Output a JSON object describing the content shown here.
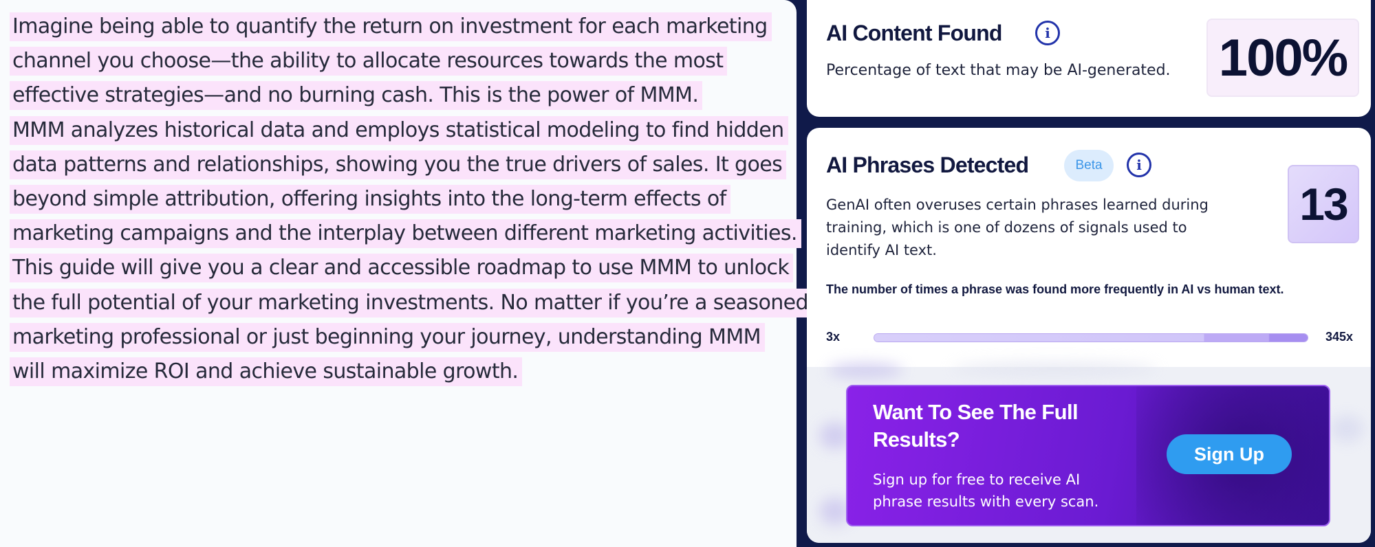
{
  "scanned_text": {
    "lines": [
      "Imagine being able to quantify the return on investment for each marketing",
      "channel you choose—the ability to allocate resources towards the most",
      "effective strategies—and no burning cash. This is the power of MMM.",
      "MMM analyzes historical data and employs statistical modeling to find hidden",
      "data patterns and relationships, showing you the true drivers of sales. It goes",
      "beyond simple attribution, offering insights into the long-term effects of",
      "marketing campaigns and the interplay between different marketing activities.",
      "This guide will give you a clear and accessible roadmap to use MMM to unlock",
      "the full potential of your marketing investments. No matter if you’re a seasoned",
      "marketing professional or just beginning your journey, understanding MMM",
      "will maximize ROI and achieve sustainable growth."
    ],
    "highlight_color": "#fbe3fb"
  },
  "ai_content": {
    "title": "AI Content Found",
    "description": "Percentage of text that may be AI-generated.",
    "value": "100%",
    "info_icon": "info-icon"
  },
  "ai_phrases": {
    "title": "AI Phrases Detected",
    "badge": "Beta",
    "info_icon": "info-icon",
    "description": "GenAI often overuses certain phrases learned during training, which is one of dozens of signals used to identify AI text.",
    "count": "13",
    "range_caption": "The number of times a phrase was found more frequently in AI vs human text.",
    "range_min": "3x",
    "range_max": "345x"
  },
  "signup": {
    "title": "Want To See The Full Results?",
    "description": "Sign up for free to receive AI phrase results with every scan.",
    "button_label": "Sign Up",
    "button_color": "#2f9cf0"
  },
  "colors": {
    "page_bg": "#101a4a",
    "banner_start": "#8a22e8",
    "banner_end": "#3e0f9a"
  }
}
